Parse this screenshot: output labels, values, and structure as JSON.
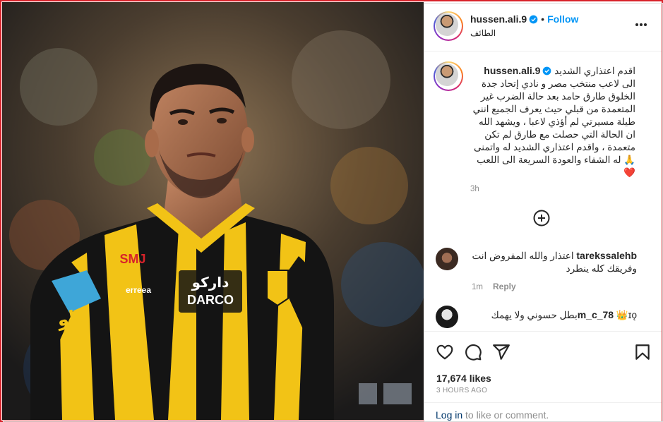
{
  "post": {
    "username": "hussen.ali.9",
    "location": "الطائف",
    "follow_label": "Follow",
    "separator": "•",
    "more_icon": "more-horizontal-icon",
    "verified_icon": "verified-badge-icon"
  },
  "photo": {
    "jersey_sponsor": "دارکو",
    "jersey_brand": "DARCO",
    "kit_maker": "erreea",
    "sleeve_sponsor": "SMJ",
    "shirt_lower_text": "يلو",
    "colors": {
      "yellow": "#f2c316",
      "black": "#141414"
    }
  },
  "caption": {
    "username": "hussen.ali.9",
    "text": "اقدم اعتذاري الشديد الى لاعب منتخب مصر و نادي إتحاد جدة الخلوق طارق حامد بعد حالة الضرب غير المتعمدة من قبلي حيث يعرف الجميع انني طيلة مسيرتي لم أؤذي لاعبا ، ويشهد الله ان الحالة التي حصلت مع طارق لم تكن متعمدة ، واقدم اعتذاري الشديد له واتمنى له الشفاء والعودة السريعة الى اللعب 🙏 ❤️",
    "time": "3h"
  },
  "load_more_icon": "plus-circle-icon",
  "comments": [
    {
      "username": "tarekssalehb",
      "text": "اعتذار والله المفروض انت وفريقك كله ينطرد",
      "time": "1m",
      "reply_label": "Reply"
    },
    {
      "username": "m_c_78",
      "badge": "👑ɪǫ",
      "text": "بطل حسوني ولا يهمك",
      "time": "",
      "reply_label": ""
    }
  ],
  "actions": {
    "like_icon": "heart-icon",
    "comment_icon": "comment-icon",
    "share_icon": "share-icon",
    "save_icon": "bookmark-icon",
    "likes": "17,674 likes",
    "posted_ago": "3 HOURS AGO"
  },
  "login": {
    "link_label": "Log in",
    "rest": " to like or comment."
  }
}
